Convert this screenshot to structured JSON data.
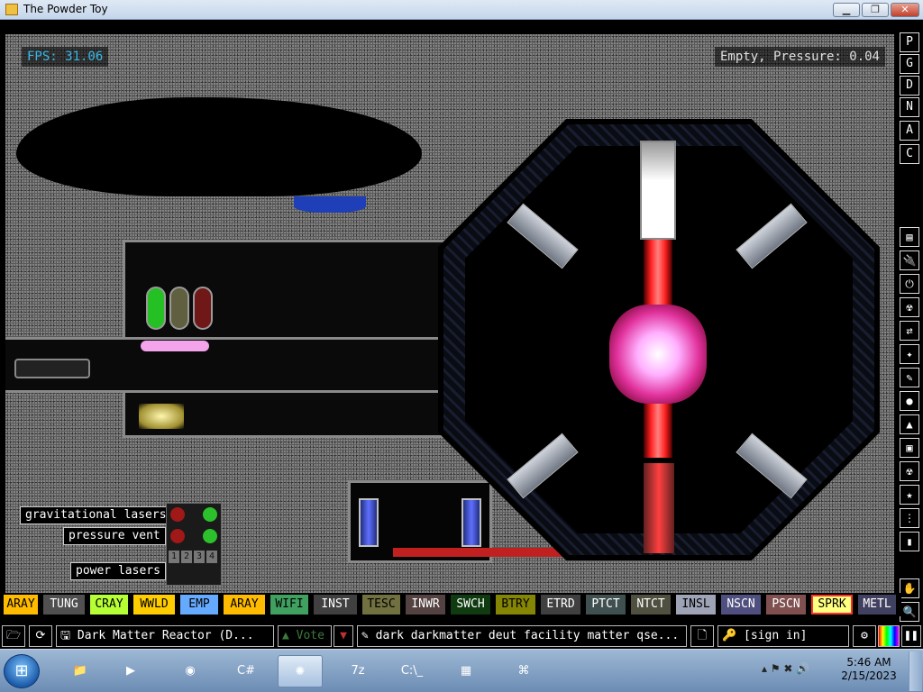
{
  "window": {
    "title": "The Powder Toy",
    "min_label": "▁",
    "max_label": "❐",
    "close_label": "✕"
  },
  "hud": {
    "fps": "FPS: 31.06",
    "status": "Empty, Pressure: 0.04"
  },
  "signs": {
    "gravitational": "gravitational lasers",
    "vent": "pressure vent",
    "power": "power lasers"
  },
  "control_numbers": [
    "1",
    "2",
    "3",
    "4"
  ],
  "right_menu_top": [
    "P",
    "G",
    "D",
    "N",
    "A",
    "C"
  ],
  "right_menu_icons": [
    "▤",
    "🔌",
    "⏻",
    "☢",
    "⇄",
    "✦",
    "✎",
    "●",
    "▲",
    "▣",
    "☢",
    "★",
    "⋮",
    "▮",
    "✋",
    "🔍"
  ],
  "elements": [
    {
      "label": "ARAY",
      "bg": "#ffbb00",
      "fg": "#000000"
    },
    {
      "label": "TUNG",
      "bg": "#505050",
      "fg": "#ffffff"
    },
    {
      "label": "CRAY",
      "bg": "#b6ff34",
      "fg": "#000000"
    },
    {
      "label": "WWLD",
      "bg": "#ffcc00",
      "fg": "#000000"
    },
    {
      "label": "EMP",
      "bg": "#66aaff",
      "fg": "#000000"
    },
    {
      "label": "ARAY",
      "bg": "#ffbb00",
      "fg": "#000000"
    },
    {
      "label": "WIFI",
      "bg": "#40a060",
      "fg": "#000000"
    },
    {
      "label": "INST",
      "bg": "#404040",
      "fg": "#ffffff"
    },
    {
      "label": "TESC",
      "bg": "#707040",
      "fg": "#000000"
    },
    {
      "label": "INWR",
      "bg": "#544141",
      "fg": "#ffffff"
    },
    {
      "label": "SWCH",
      "bg": "#103b11",
      "fg": "#ffffff"
    },
    {
      "label": "BTRY",
      "bg": "#858505",
      "fg": "#000000"
    },
    {
      "label": "ETRD",
      "bg": "#404040",
      "fg": "#ffffff"
    },
    {
      "label": "PTCT",
      "bg": "#405050",
      "fg": "#ffffff"
    },
    {
      "label": "NTCT",
      "bg": "#505040",
      "fg": "#ffffff"
    },
    {
      "label": "INSL",
      "bg": "#9ea3b6",
      "fg": "#000000"
    },
    {
      "label": "NSCN",
      "bg": "#505080",
      "fg": "#ffffff"
    },
    {
      "label": "PSCN",
      "bg": "#805050",
      "fg": "#ffffff"
    },
    {
      "label": "SPRK",
      "bg": "#ffff80",
      "fg": "#000000"
    },
    {
      "label": "METL",
      "bg": "#404060",
      "fg": "#ffffff"
    }
  ],
  "bottombar": {
    "save_name": "Dark Matter Reactor (D...",
    "vote_label": "Vote",
    "tags": "dark darkmatter deut facility matter qse...",
    "sign_in": "[sign in]",
    "open_icon": "🗁",
    "reload_icon": "⟳",
    "save_icon": "🖫",
    "up_icon": "▲",
    "down_icon": "▼",
    "tags_icon": "✎",
    "new_icon": "🗋",
    "user_icon": "🔑",
    "settings_icon": "⚙",
    "pause_icon": "❚❚"
  },
  "taskbar": {
    "start_icon": "⊞",
    "apps": [
      {
        "name": "explorer",
        "icon": "📁",
        "active": false
      },
      {
        "name": "media",
        "icon": "▶",
        "active": false
      },
      {
        "name": "chrome",
        "icon": "◉",
        "active": false
      },
      {
        "name": "csharp",
        "icon": "C#",
        "active": false
      },
      {
        "name": "powdertoy",
        "icon": "✺",
        "active": true
      },
      {
        "name": "7zip",
        "icon": "7z",
        "active": false
      },
      {
        "name": "cmd",
        "icon": "C:\\_",
        "active": false
      },
      {
        "name": "devices",
        "icon": "▦",
        "active": false
      },
      {
        "name": "network",
        "icon": "⌘",
        "active": false
      }
    ],
    "tray": "▴  ⚑  ✖  🔊",
    "time": "5:46 AM",
    "date": "2/15/2023"
  }
}
